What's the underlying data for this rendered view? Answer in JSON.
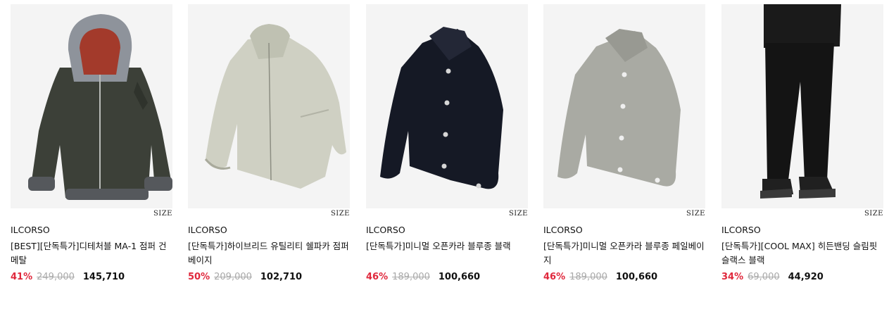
{
  "products": [
    {
      "brand": "ILCORSO",
      "title": "[BEST][단독특가]디테처블 MA-1 점퍼 건메탈",
      "size_label": "SIZE",
      "discount": "41%",
      "original_price": "249,000",
      "sale_price": "145,710",
      "image_icon": "hooded-bomber-jacket-image"
    },
    {
      "brand": "ILCORSO",
      "title": "[단독특가]하이브리드 유틸리티 쉘파카 점퍼 베이지",
      "size_label": "SIZE",
      "discount": "50%",
      "original_price": "209,000",
      "sale_price": "102,710",
      "image_icon": "beige-zip-jacket-image"
    },
    {
      "brand": "ILCORSO",
      "title": "[단독특가]미니멀 오픈카라 블루종 블랙",
      "size_label": "SIZE",
      "discount": "46%",
      "original_price": "189,000",
      "sale_price": "100,660",
      "image_icon": "black-blouson-image"
    },
    {
      "brand": "ILCORSO",
      "title": "[단독특가]미니멀 오픈카라 블루종 페일베이지",
      "size_label": "SIZE",
      "discount": "46%",
      "original_price": "189,000",
      "sale_price": "100,660",
      "image_icon": "pale-beige-blouson-image"
    },
    {
      "brand": "ILCORSO",
      "title": "[단독특가][COOL MAX] 히든밴딩 슬림핏 슬랙스 블랙",
      "size_label": "SIZE",
      "discount": "34%",
      "original_price": "69,000",
      "sale_price": "44,920",
      "image_icon": "black-slacks-image"
    }
  ],
  "colors": {
    "discount": "#e0283c",
    "original_price": "#a9a9a9",
    "thumb_bg": "#f4f4f4"
  }
}
